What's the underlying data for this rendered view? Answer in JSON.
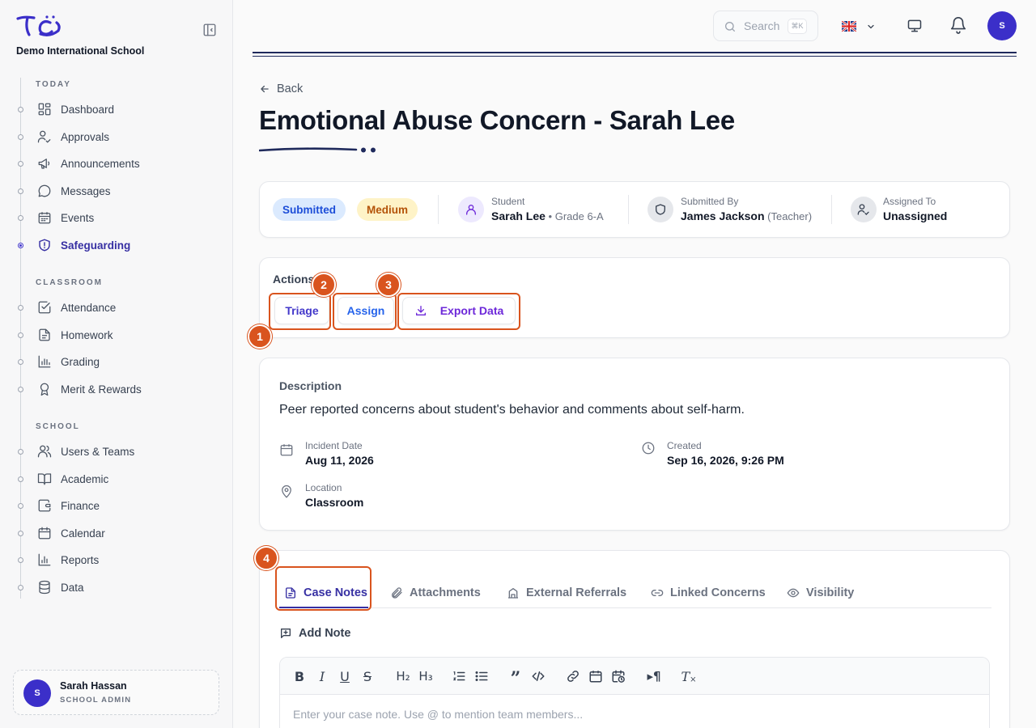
{
  "app": {
    "school_name": "Demo International School"
  },
  "sidebar": {
    "sections": [
      {
        "title": "TODAY"
      },
      {
        "title": "CLASSROOM"
      },
      {
        "title": "SCHOOL"
      }
    ],
    "items": [
      {
        "label": "Dashboard",
        "icon": "dashboard-icon"
      },
      {
        "label": "Approvals",
        "icon": "user-check-icon"
      },
      {
        "label": "Announcements",
        "icon": "megaphone-icon"
      },
      {
        "label": "Messages",
        "icon": "message-icon"
      },
      {
        "label": "Events",
        "icon": "calendar-grid-icon"
      },
      {
        "label": "Safeguarding",
        "icon": "shield-alert-icon",
        "active": true
      },
      {
        "label": "Attendance",
        "icon": "check-square-icon"
      },
      {
        "label": "Homework",
        "icon": "file-text-icon"
      },
      {
        "label": "Grading",
        "icon": "bar-chart-icon"
      },
      {
        "label": "Merit & Rewards",
        "icon": "award-icon"
      },
      {
        "label": "Users & Teams",
        "icon": "users-icon"
      },
      {
        "label": "Academic",
        "icon": "book-open-icon"
      },
      {
        "label": "Finance",
        "icon": "wallet-icon"
      },
      {
        "label": "Calendar",
        "icon": "calendar-icon"
      },
      {
        "label": "Reports",
        "icon": "chart-icon"
      },
      {
        "label": "Data",
        "icon": "database-icon"
      }
    ],
    "user": {
      "initial": "S",
      "name": "Sarah Hassan",
      "role": "SCHOOL ADMIN"
    }
  },
  "topbar": {
    "search_placeholder": "Search",
    "search_shortcut": "⌘K",
    "avatar_initial": "S"
  },
  "page": {
    "back_label": "Back",
    "title": "Emotional Abuse Concern - Sarah Lee",
    "status": "Submitted",
    "severity": "Medium",
    "student": {
      "label": "Student",
      "name": "Sarah Lee",
      "detail": " • Grade 6-A"
    },
    "submitted_by": {
      "label": "Submitted By",
      "name": "James Jackson",
      "detail": " (Teacher)"
    },
    "assigned_to": {
      "label": "Assigned To",
      "value": "Unassigned"
    },
    "actions": {
      "title": "Actions",
      "triage": "Triage",
      "assign": "Assign",
      "export": "Export Data"
    },
    "description": {
      "label": "Description",
      "text": "Peer reported concerns about student's behavior and comments about self-harm.",
      "incident_date_label": "Incident Date",
      "incident_date": "Aug 11, 2026",
      "created_label": "Created",
      "created": "Sep 16, 2026, 9:26 PM",
      "location_label": "Location",
      "location": "Classroom"
    },
    "tabs": [
      {
        "label": "Case Notes",
        "active": true
      },
      {
        "label": "Attachments"
      },
      {
        "label": "External Referrals"
      },
      {
        "label": "Linked Concerns"
      },
      {
        "label": "Visibility"
      }
    ],
    "add_note_label": "Add Note",
    "editor_placeholder": "Enter your case note. Use @ to mention team members..."
  },
  "annotations": [
    "1",
    "2",
    "3",
    "4"
  ],
  "colors": {
    "accent": "#3730a3",
    "annotation": "#d9541e",
    "submitted_bg": "#dbeafe",
    "medium_bg": "#fef3c7"
  }
}
